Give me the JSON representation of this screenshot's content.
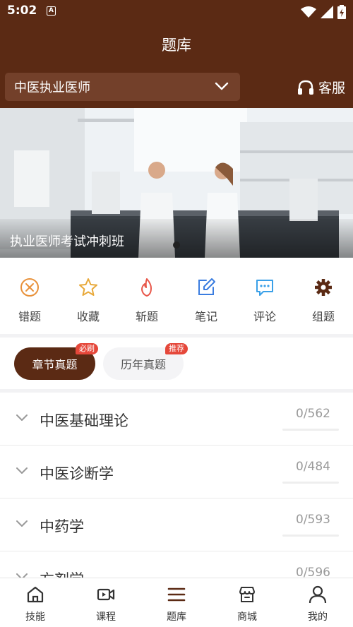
{
  "status_bar": {
    "time": "5:02"
  },
  "header": {
    "title": "题库",
    "exam_selector": "中医执业医师",
    "service_label": "客服"
  },
  "banner": {
    "caption": "执业医师考试冲刺班"
  },
  "shortcuts": [
    {
      "label": "错题",
      "icon": "x-circle-icon",
      "color": "#e8913a"
    },
    {
      "label": "收藏",
      "icon": "star-icon",
      "color": "#e8a93a"
    },
    {
      "label": "斩题",
      "icon": "flame-icon",
      "color": "#e8574a"
    },
    {
      "label": "笔记",
      "icon": "edit-note-icon",
      "color": "#3b7de0"
    },
    {
      "label": "评论",
      "icon": "comment-icon",
      "color": "#3aa0e8"
    },
    {
      "label": "组题",
      "icon": "gear-icon",
      "color": "#5b2a14"
    }
  ],
  "tabs": [
    {
      "label": "章节真题",
      "badge": "必刷",
      "active": true
    },
    {
      "label": "历年真题",
      "badge": "推荐",
      "active": false
    }
  ],
  "chapters": [
    {
      "title": "中医基础理论",
      "progress": "0/562"
    },
    {
      "title": "中医诊断学",
      "progress": "0/484"
    },
    {
      "title": "中药学",
      "progress": "0/593"
    },
    {
      "title": "方剂学",
      "progress": "0/596"
    }
  ],
  "bottom_nav": [
    {
      "label": "技能",
      "icon": "home-icon"
    },
    {
      "label": "课程",
      "icon": "video-icon"
    },
    {
      "label": "题库",
      "icon": "menu-icon",
      "active": true
    },
    {
      "label": "商城",
      "icon": "store-icon"
    },
    {
      "label": "我的",
      "icon": "user-icon"
    }
  ]
}
